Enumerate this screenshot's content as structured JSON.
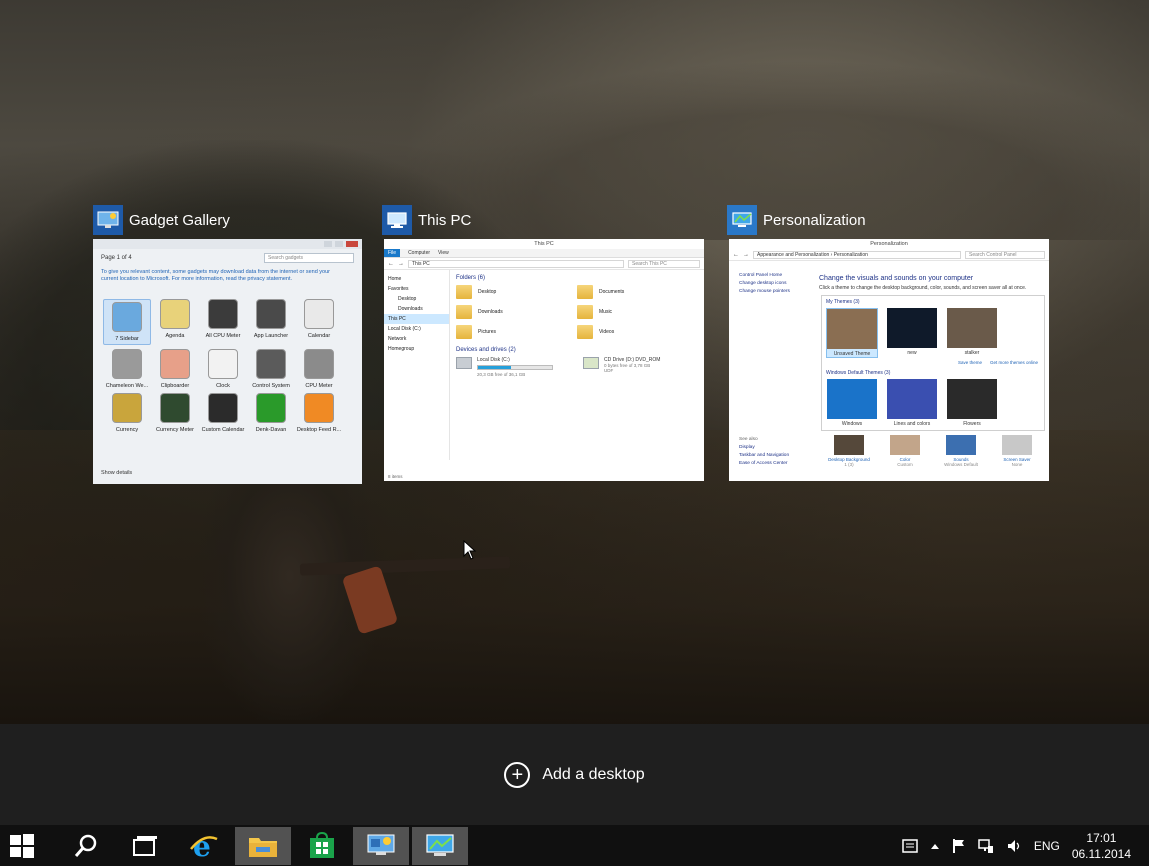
{
  "windows": [
    {
      "title": "Gadget Gallery",
      "icon": "gadget-gallery-icon"
    },
    {
      "title": "This PC",
      "icon": "this-pc-icon"
    },
    {
      "title": "Personalization",
      "icon": "personalization-icon"
    }
  ],
  "gadget_gallery": {
    "page": "Page 1 of 4",
    "search_placeholder": "Search gadgets",
    "notice": "To give you relevant content, some gadgets may download data from the internet or send your current location to Microsoft. For more information, read the privacy statement.",
    "gadgets": [
      {
        "label": "7 Sidebar",
        "color": "#6aa9de"
      },
      {
        "label": "Agenda",
        "color": "#e8d27a"
      },
      {
        "label": "All CPU Meter",
        "color": "#3b3b3b"
      },
      {
        "label": "App Launcher",
        "color": "#4a4a4a"
      },
      {
        "label": "Calendar",
        "color": "#e9e9e9"
      },
      {
        "label": "Chameleon We...",
        "color": "#9a9a9a"
      },
      {
        "label": "Clipboarder",
        "color": "#e7a089"
      },
      {
        "label": "Clock",
        "color": "#f2f2f2"
      },
      {
        "label": "Control System",
        "color": "#5b5b5b"
      },
      {
        "label": "CPU Meter",
        "color": "#8b8b8b"
      },
      {
        "label": "Currency",
        "color": "#c9a53c"
      },
      {
        "label": "Currency Meter",
        "color": "#2f4a2f"
      },
      {
        "label": "Custom Calendar",
        "color": "#2b2b2b"
      },
      {
        "label": "Denk-Davan",
        "color": "#2a9a2a"
      },
      {
        "label": "Desktop Feed R...",
        "color": "#f08a24"
      }
    ],
    "show_details": "Show details"
  },
  "this_pc": {
    "title": "This PC",
    "tabs": [
      "File",
      "Computer",
      "View"
    ],
    "address": "This PC",
    "search_placeholder": "Search This PC",
    "nav": [
      {
        "label": "Home",
        "sub": false,
        "active": false
      },
      {
        "label": "Favorites",
        "sub": false,
        "active": false
      },
      {
        "label": "Desktop",
        "sub": true,
        "active": false
      },
      {
        "label": "Downloads",
        "sub": true,
        "active": false
      },
      {
        "label": "This PC",
        "sub": false,
        "active": true
      },
      {
        "label": "Local Disk (C:)",
        "sub": false,
        "active": false
      },
      {
        "label": "Network",
        "sub": false,
        "active": false
      },
      {
        "label": "Homegroup",
        "sub": false,
        "active": false
      }
    ],
    "folders_header": "Folders (6)",
    "folders": [
      "Desktop",
      "Documents",
      "Downloads",
      "Music",
      "Pictures",
      "Videos"
    ],
    "drives_header": "Devices and drives (2)",
    "drive_c": {
      "name": "Local Disk (C:)",
      "free": "20,3 GB free of 36,1 GB",
      "used_fraction": 0.44
    },
    "drive_d": {
      "name": "CD Drive (D:) DVD_ROM",
      "free": "0 bytes free of 3,78 GB",
      "fs": "UDF"
    },
    "status": "8 items"
  },
  "personalization": {
    "title": "Personalization",
    "address": "Appearance and Personalization  ›  Personalization",
    "search_placeholder": "Search Control Panel",
    "side_links": [
      "Control Panel Home",
      "Change desktop icons",
      "Change mouse pointers"
    ],
    "heading": "Change the visuals and sounds on your computer",
    "description": "Click a theme to change the desktop background, color, sounds, and screen saver all at once.",
    "my_themes_header": "My Themes (3)",
    "my_themes": [
      {
        "label": "Unsaved Theme",
        "color": "#8a6e52"
      },
      {
        "label": "new",
        "color": "#0f1a2a"
      },
      {
        "label": "stalker",
        "color": "#6a5a4a"
      }
    ],
    "save_theme": "Save theme",
    "more_themes": "Get more themes online",
    "default_header": "Windows Default Themes (3)",
    "default_themes": [
      {
        "label": "Windows",
        "color": "#1a73c9"
      },
      {
        "label": "Lines and colors",
        "color": "#3a4fb0"
      },
      {
        "label": "Flowers",
        "color": "#2a2a2a"
      }
    ],
    "see_also_header": "See also",
    "see_also": [
      "Display",
      "Taskbar and Navigation",
      "Ease of Access Center"
    ],
    "bottom": [
      {
        "label": "Desktop Background",
        "sub": "1 (3)",
        "color": "#55483a"
      },
      {
        "label": "Color",
        "sub": "Custom",
        "color": "#c2a58a"
      },
      {
        "label": "Sounds",
        "sub": "Windows Default",
        "color": "#3c6fb0"
      },
      {
        "label": "Screen Saver",
        "sub": "None",
        "color": "#c8c8c8"
      }
    ]
  },
  "add_desktop": {
    "label": "Add a desktop"
  },
  "taskbar": {
    "items": [
      "start-icon",
      "search-icon",
      "task-view-icon",
      "internet-explorer-icon",
      "file-explorer-icon",
      "store-icon",
      "gadget-app-icon",
      "personalization-app-icon"
    ],
    "language": "ENG",
    "time": "17:01",
    "date": "06.11.2014"
  }
}
